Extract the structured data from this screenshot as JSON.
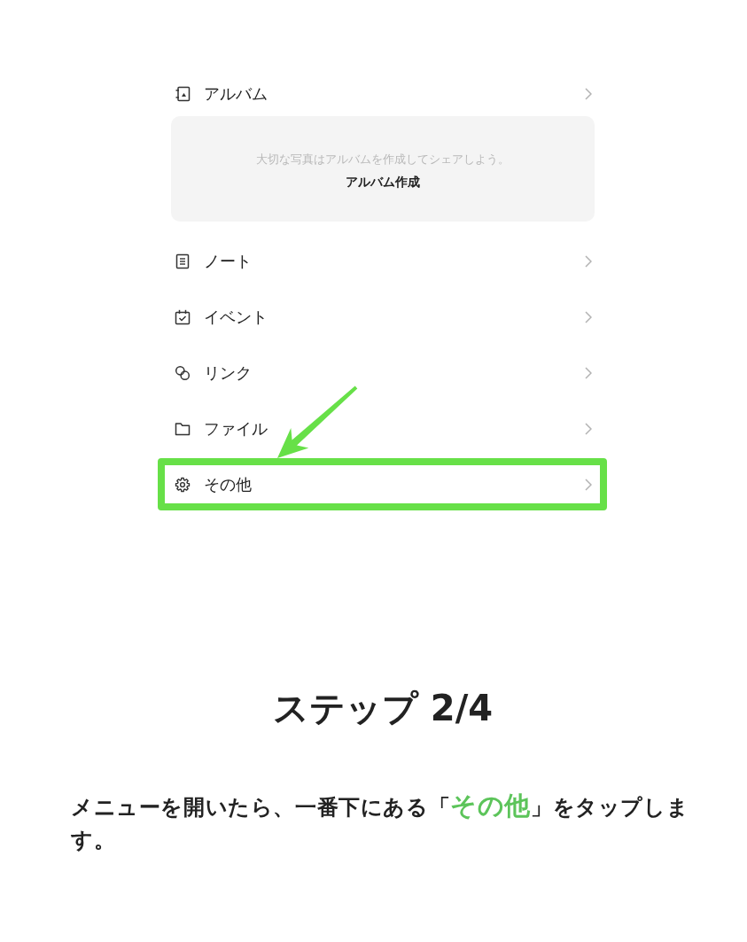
{
  "menu": {
    "items": [
      {
        "kind": "album",
        "label": "アルバム",
        "highlighted": false,
        "card": {
          "message": "大切な写真はアルバムを作成してシェアしよう。",
          "action": "アルバム作成"
        }
      },
      {
        "kind": "note",
        "label": "ノート",
        "highlighted": false
      },
      {
        "kind": "event",
        "label": "イベント",
        "highlighted": false
      },
      {
        "kind": "link",
        "label": "リンク",
        "highlighted": false
      },
      {
        "kind": "file",
        "label": "ファイル",
        "highlighted": false
      },
      {
        "kind": "more",
        "label": "その他",
        "highlighted": true
      }
    ]
  },
  "step": {
    "title": "ステップ 2/4"
  },
  "instruction": {
    "parts": [
      {
        "text": "メニューを開いたら、一番下にある「",
        "emphasis": false
      },
      {
        "text": "その他",
        "emphasis": true
      },
      {
        "text": "」をタップします。",
        "emphasis": false
      }
    ]
  }
}
